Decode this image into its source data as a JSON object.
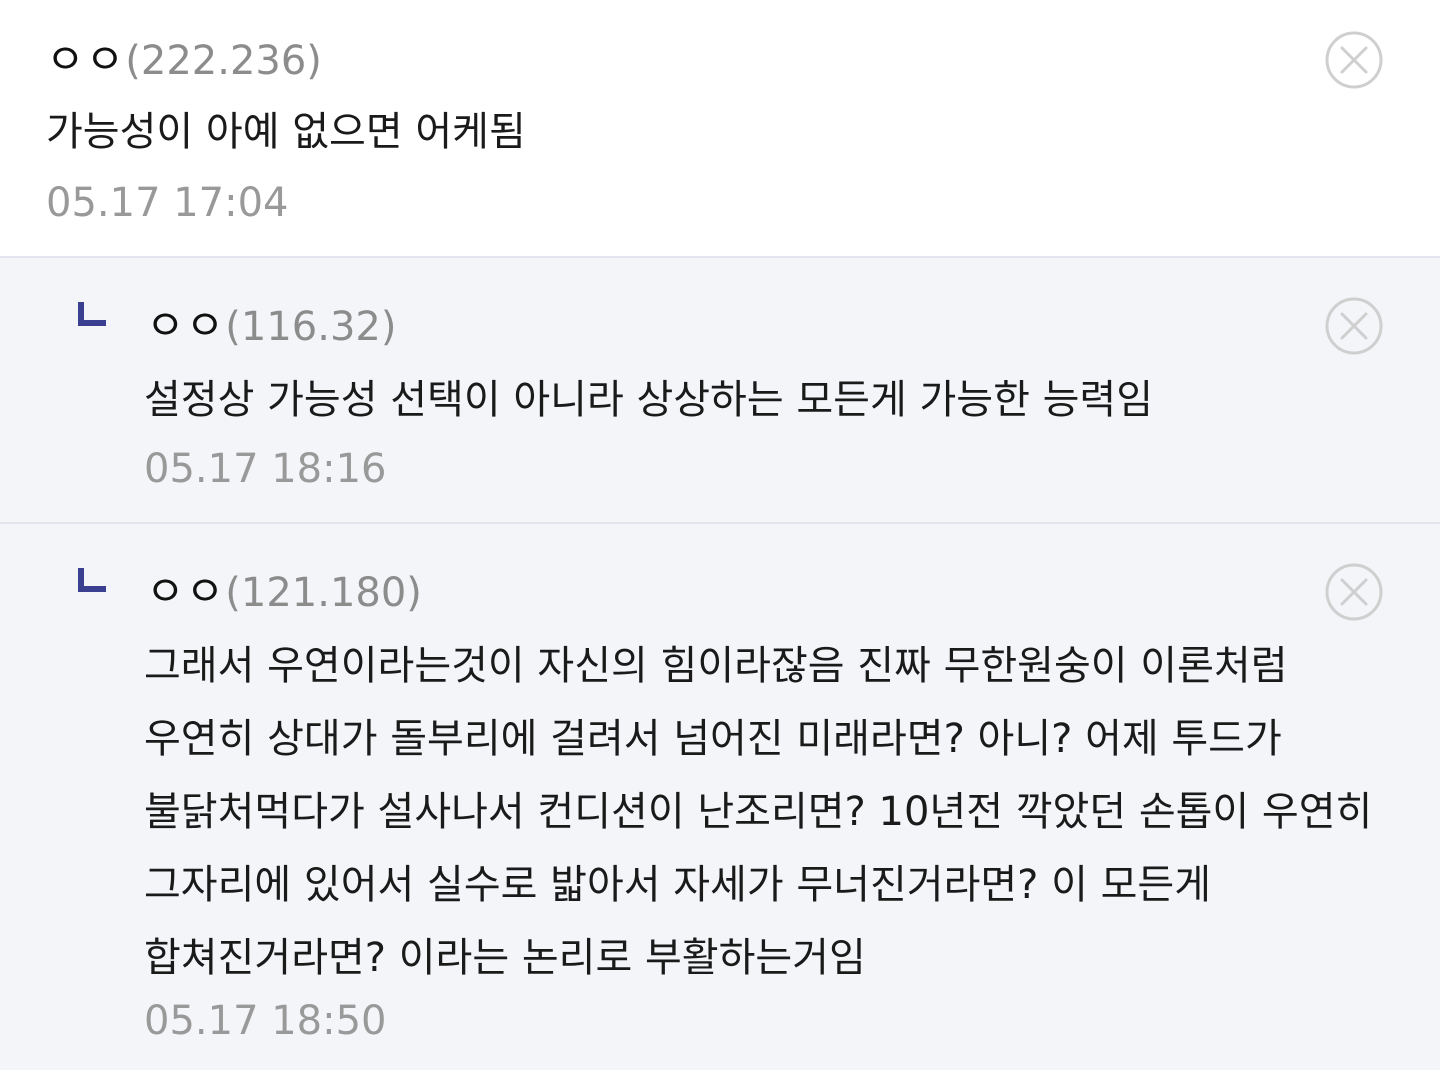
{
  "comments": [
    {
      "nick": "ㅇㅇ",
      "ip": "(222.236)",
      "text": "가능성이 아예 없으면 어케됨",
      "time": "05.17 17:04"
    },
    {
      "nick": "ㅇㅇ",
      "ip": "(116.32)",
      "text": "설정상 가능성 선택이 아니라 상상하는 모든게 가능한 능력임",
      "time": "05.17 18:16"
    },
    {
      "nick": "ㅇㅇ",
      "ip": "(121.180)",
      "text": "그래서 우연이라는것이 자신의 힘이라잖음 진짜 무한원숭이 이론처럼 우연히 상대가 돌부리에 걸려서 넘어진 미래라면? 아니? 어제 투드가 불닭처먹다가 설사나서 컨디션이 난조리면? 10년전 깍았던 손톱이 우연히 그자리에 있어서 실수로 밟아서 자세가 무너진거라면? 이 모든게 합쳐진거라면? 이라는 논리로 부활하는거임",
      "time": "05.17 18:50"
    }
  ],
  "icons": {
    "delete": "close-circle-icon",
    "reply": "reply-arrow-icon"
  },
  "colors": {
    "reply_mark": "#3b3f8f",
    "reply_bg": "#f4f5f9",
    "divider": "#e3e5ee",
    "meta_gray": "#999999"
  }
}
